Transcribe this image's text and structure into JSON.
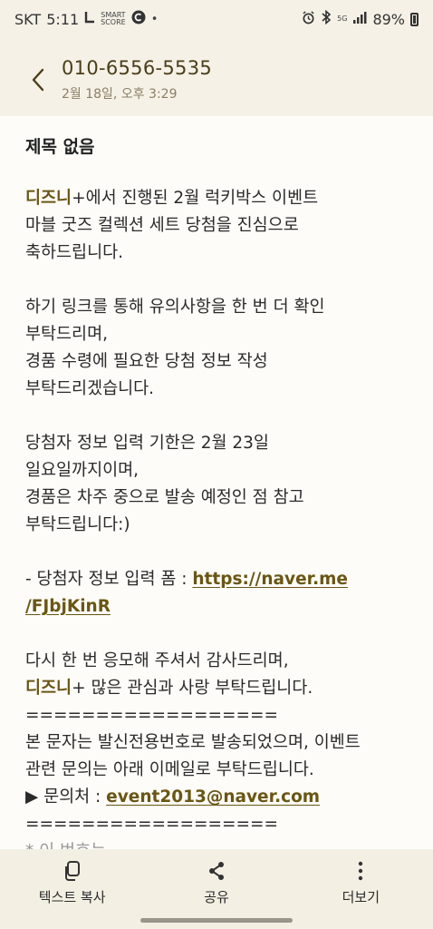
{
  "status_bar": {
    "carrier": "SKT",
    "time": "5:11",
    "smart_score": "SMART\nSCORE",
    "network": "5G",
    "battery": "89%"
  },
  "header": {
    "phone_number": "010-6556-5535",
    "date": "2월 18일, 오후 3:29"
  },
  "message": {
    "title": "제목 없음",
    "brand": "디즈니",
    "line1_rest": "+에서 진행된 2월 럭키박스 이벤트",
    "line2": "마블 굿즈 컬렉션 세트 당첨을 진심으로",
    "line3": "축하드립니다.",
    "line4": "하기 링크를 통해 유의사항을 한 번 더 확인",
    "line5": "부탁드리며,",
    "line6": "경품 수령에 필요한 당첨 정보 작성",
    "line7": "부탁드리겠습니다.",
    "line8": "당첨자 정보 입력 기한은 2월 23일",
    "line9": "일요일까지이며,",
    "line10": "경품은 차주 중으로 발송 예정인 점 참고",
    "line11": "부탁드립니다:)",
    "form_label": "- 당첨자 정보 입력 폼 : ",
    "link_part1": "https://naver.me",
    "link_part2": "/FJbjKinR",
    "line12": "다시 한 번 응모해 주셔서 감사드리며,",
    "line13_rest": "+ 많은 관심과 사랑 부탁드립니다.",
    "separator": "==================",
    "line14": "본 문자는 발신전용번호로 발송되었으며, 이벤트",
    "line15": "관련 문의는 아래 이메일로 부탁드립니다.",
    "contact_label": "▶ 문의처 : ",
    "email": "event2013@naver.com",
    "separator2": "==================",
    "cut_text": "* 이 번호는"
  },
  "bottom_bar": {
    "copy_label": "텍스트 복사",
    "share_label": "공유",
    "more_label": "더보기"
  },
  "colors": {
    "background": "#f5f1e6",
    "message_bg": "#fdfcf8",
    "accent": "#6a5614"
  }
}
